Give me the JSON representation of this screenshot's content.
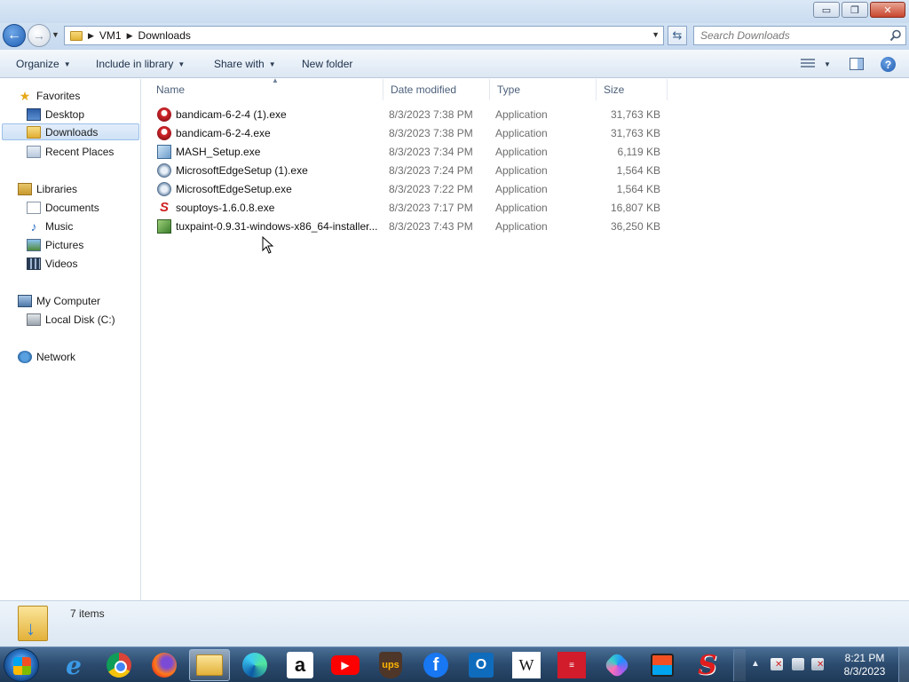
{
  "window": {
    "controls": {
      "minimize": "▭",
      "maximize": "❐",
      "close": "✕"
    }
  },
  "address": {
    "breadcrumbs": [
      "VM1",
      "Downloads"
    ],
    "search_placeholder": "Search Downloads"
  },
  "toolbar": {
    "organize": "Organize",
    "include_in_library": "Include in library",
    "share_with": "Share with",
    "new_folder": "New folder"
  },
  "nav": {
    "favorites": {
      "label": "Favorites",
      "icon": "star-icon"
    },
    "desktop": {
      "label": "Desktop",
      "icon": "desktop-icon"
    },
    "downloads": {
      "label": "Downloads",
      "icon": "downloads-folder-icon",
      "selected": true
    },
    "recent": {
      "label": "Recent Places",
      "icon": "recent-places-icon"
    },
    "libraries": {
      "label": "Libraries",
      "icon": "libraries-icon"
    },
    "documents": {
      "label": "Documents",
      "icon": "documents-icon"
    },
    "music": {
      "label": "Music",
      "icon": "music-icon"
    },
    "pictures": {
      "label": "Pictures",
      "icon": "pictures-icon"
    },
    "videos": {
      "label": "Videos",
      "icon": "videos-icon"
    },
    "computer": {
      "label": "My Computer",
      "icon": "computer-icon"
    },
    "localdisk": {
      "label": "Local Disk (C:)",
      "icon": "disk-icon"
    },
    "network": {
      "label": "Network",
      "icon": "network-icon"
    }
  },
  "columns": {
    "name": "Name",
    "date": "Date modified",
    "type": "Type",
    "size": "Size"
  },
  "files": [
    {
      "name": "bandicam-6-2-4 (1).exe",
      "date": "8/3/2023 7:38 PM",
      "type": "Application",
      "size": "31,763 KB",
      "icon": "bandicam-icon"
    },
    {
      "name": "bandicam-6-2-4.exe",
      "date": "8/3/2023 7:38 PM",
      "type": "Application",
      "size": "31,763 KB",
      "icon": "bandicam-icon"
    },
    {
      "name": "MASH_Setup.exe",
      "date": "8/3/2023 7:34 PM",
      "type": "Application",
      "size": "6,119 KB",
      "icon": "installer-icon"
    },
    {
      "name": "MicrosoftEdgeSetup (1).exe",
      "date": "8/3/2023 7:24 PM",
      "type": "Application",
      "size": "1,564 KB",
      "icon": "edge-setup-icon"
    },
    {
      "name": "MicrosoftEdgeSetup.exe",
      "date": "8/3/2023 7:22 PM",
      "type": "Application",
      "size": "1,564 KB",
      "icon": "edge-setup-icon"
    },
    {
      "name": "souptoys-1.6.0.8.exe",
      "date": "8/3/2023 7:17 PM",
      "type": "Application",
      "size": "16,807 KB",
      "icon": "souptoys-icon"
    },
    {
      "name": "tuxpaint-0.9.31-windows-x86_64-installer...",
      "date": "8/3/2023 7:43 PM",
      "type": "Application",
      "size": "36,250 KB",
      "icon": "tuxpaint-icon"
    }
  ],
  "status": {
    "item_count": "7 items"
  },
  "taskbar": {
    "apps": [
      "Internet Explorer",
      "Chrome",
      "Firefox",
      "File Explorer",
      "Edge",
      "Amazon",
      "YouTube",
      "UPS",
      "Facebook",
      "Outlook",
      "Wikipedia",
      "Bank of America",
      "Copilot",
      "Microsoft Store",
      "SoupToys"
    ],
    "glyphs": {
      "ie": "e",
      "amazon": "a",
      "youtube": "▶",
      "ups": "ups",
      "facebook": "f",
      "outlook": "O",
      "wikipedia": "W",
      "boa": "≡",
      "soup": "S"
    },
    "clock_time": "8:21 PM",
    "clock_date": "8/3/2023"
  },
  "colors": {
    "accent": "#1f5fb3",
    "selection": "#cfe1f6",
    "taskbar": "#2b4a6d"
  }
}
